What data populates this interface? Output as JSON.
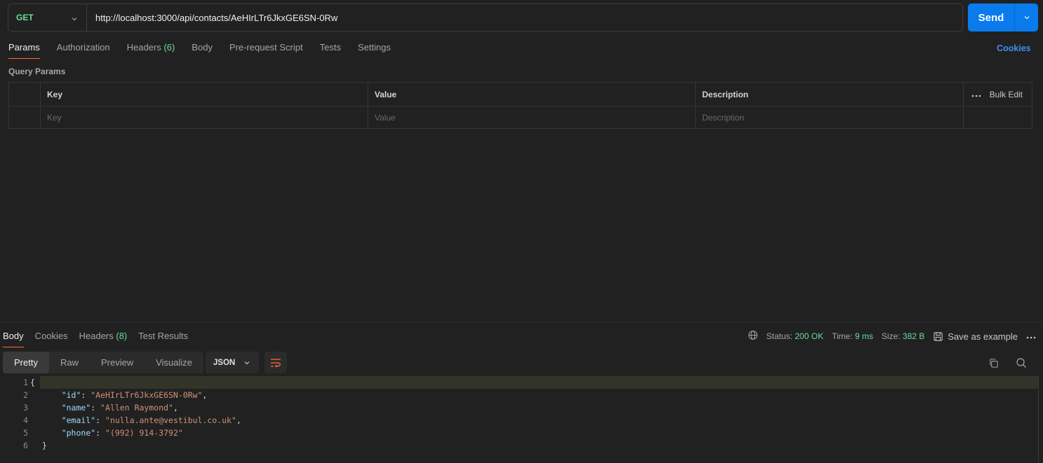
{
  "request": {
    "method": "GET",
    "url": "http://localhost:3000/api/contacts/AeHIrLTr6JkxGE6SN-0Rw",
    "send_label": "Send",
    "tabs": [
      {
        "label": "Params",
        "count": ""
      },
      {
        "label": "Authorization",
        "count": ""
      },
      {
        "label": "Headers",
        "count": "(6)"
      },
      {
        "label": "Body",
        "count": ""
      },
      {
        "label": "Pre-request Script",
        "count": ""
      },
      {
        "label": "Tests",
        "count": ""
      },
      {
        "label": "Settings",
        "count": ""
      }
    ],
    "cookies_label": "Cookies",
    "query_params_title": "Query Params",
    "table": {
      "headers": [
        "Key",
        "Value",
        "Description"
      ],
      "bulk_edit": "Bulk Edit",
      "placeholders": [
        "Key",
        "Value",
        "Description"
      ]
    }
  },
  "response": {
    "tabs": [
      {
        "label": "Body",
        "count": ""
      },
      {
        "label": "Cookies",
        "count": ""
      },
      {
        "label": "Headers",
        "count": "(8)"
      },
      {
        "label": "Test Results",
        "count": ""
      }
    ],
    "status_label": "Status:",
    "status_value": "200 OK",
    "time_label": "Time:",
    "time_value": "9 ms",
    "size_label": "Size:",
    "size_value": "382 B",
    "save_example": "Save as example",
    "views": [
      "Pretty",
      "Raw",
      "Preview",
      "Visualize"
    ],
    "format": "JSON",
    "code_lines": [
      {
        "n": "1",
        "parts": [
          [
            "p",
            "{"
          ]
        ]
      },
      {
        "n": "2",
        "parts": [
          [
            "p",
            "    "
          ],
          [
            "k",
            "\"id\""
          ],
          [
            "p",
            ": "
          ],
          [
            "s",
            "\"AeHIrLTr6JkxGE6SN-0Rw\""
          ],
          [
            "p",
            ","
          ]
        ]
      },
      {
        "n": "3",
        "parts": [
          [
            "p",
            "    "
          ],
          [
            "k",
            "\"name\""
          ],
          [
            "p",
            ": "
          ],
          [
            "s",
            "\"Allen Raymond\""
          ],
          [
            "p",
            ","
          ]
        ]
      },
      {
        "n": "4",
        "parts": [
          [
            "p",
            "    "
          ],
          [
            "k",
            "\"email\""
          ],
          [
            "p",
            ": "
          ],
          [
            "s",
            "\"nulla.ante@vestibul.co.uk\""
          ],
          [
            "p",
            ","
          ]
        ]
      },
      {
        "n": "5",
        "parts": [
          [
            "p",
            "    "
          ],
          [
            "k",
            "\"phone\""
          ],
          [
            "p",
            ": "
          ],
          [
            "s",
            "\"(992) 914-3792\""
          ]
        ]
      },
      {
        "n": "6",
        "parts": [
          [
            "p",
            "}"
          ]
        ]
      }
    ]
  },
  "colors": {
    "accent_orange": "#ff6c37",
    "send_blue": "#097bed",
    "method_green": "#6bdd9a",
    "link_blue": "#3d8ff2"
  }
}
